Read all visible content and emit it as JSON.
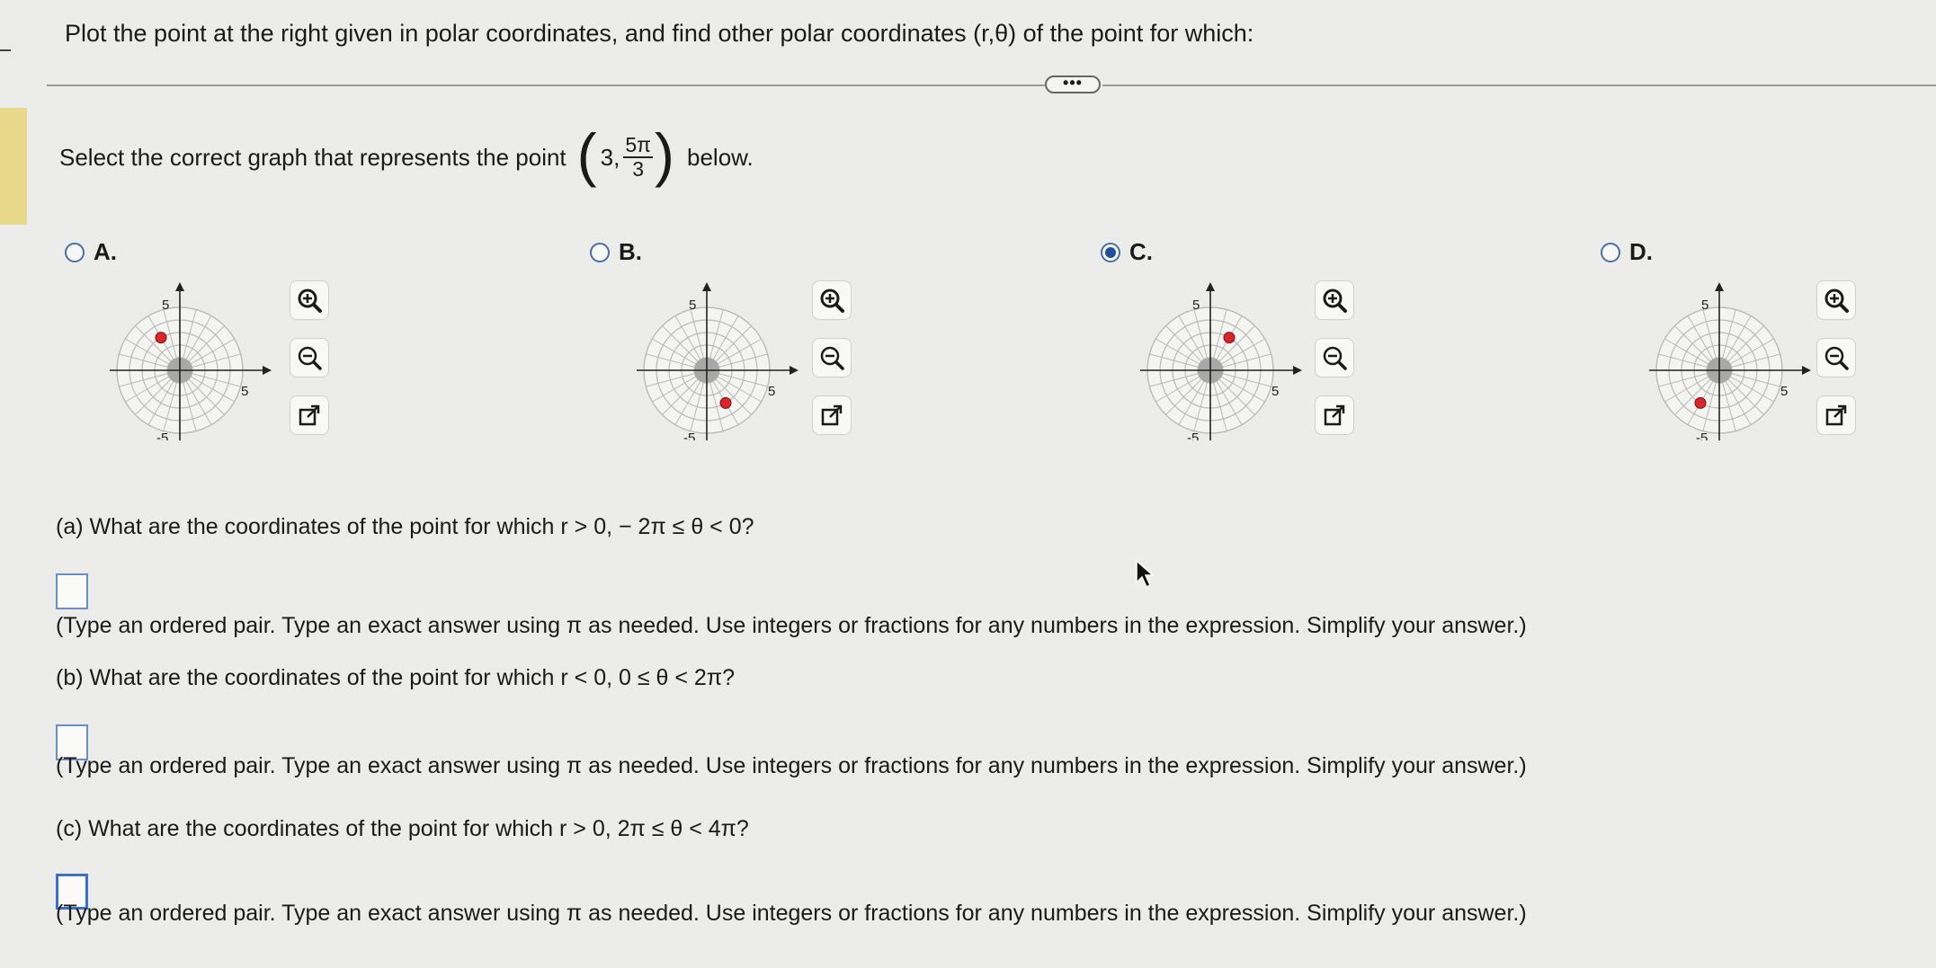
{
  "prompt": "Plot the point at the right given in polar coordinates, and find other polar coordinates (r,θ) of the point for which:",
  "more_label": "•••",
  "select": {
    "text": "Select the correct graph that represents the point",
    "point_r": "3,",
    "frac_num": "5π",
    "frac_den": "3",
    "after": "below."
  },
  "options": [
    {
      "letter": "A.",
      "selected": false,
      "point": {
        "r": 3,
        "angle_deg": 120
      }
    },
    {
      "letter": "B.",
      "selected": false,
      "point": {
        "r": 3,
        "angle_deg": 300
      }
    },
    {
      "letter": "C.",
      "selected": true,
      "point": {
        "r": 3,
        "angle_deg": 60
      }
    },
    {
      "letter": "D.",
      "selected": false,
      "point": {
        "r": 3,
        "angle_deg": 240
      }
    }
  ],
  "axis": {
    "pos": "5",
    "neg": "-5"
  },
  "questions": {
    "a": "(a) What are the coordinates of the point for which r > 0,  − 2π ≤ θ < 0?",
    "b": "(b) What are the coordinates of the point for which r < 0, 0 ≤ θ < 2π?",
    "c": "(c) What are the coordinates of the point for which r > 0, 2π ≤ θ < 4π?"
  },
  "hint": "(Type an ordered pair. Type an exact answer using π as needed. Use integers or fractions for any numbers in the expression. Simplify your answer.)",
  "colors": {
    "point": "#d9262a",
    "radio": "#1f4f9a",
    "grid": "#b9b9b9"
  },
  "icons": [
    "zoom-in-icon",
    "zoom-out-icon",
    "popout-icon"
  ]
}
